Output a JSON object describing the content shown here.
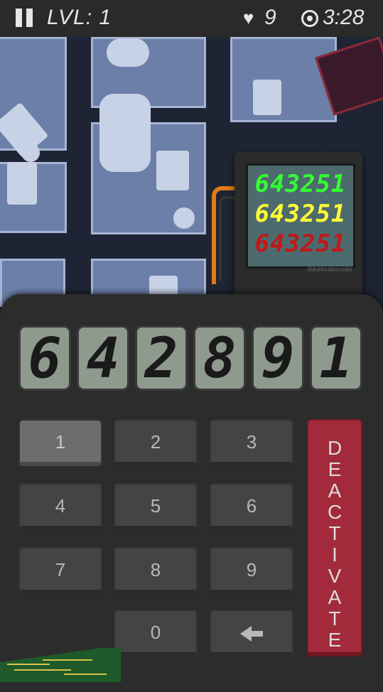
{
  "hud": {
    "level": "LVL: 1",
    "lives": "9",
    "timer": "3:28",
    "icons": [
      "pause-icon",
      "heart-icon",
      "clock-icon"
    ]
  },
  "device": {
    "codes": [
      "643251",
      "643251",
      "643251"
    ],
    "code_colors": [
      "#33ff33",
      "#ffff33",
      "#c01818"
    ],
    "brand": "iliketodecode"
  },
  "keypad": {
    "display": [
      "6",
      "4",
      "2",
      "8",
      "9",
      "1"
    ],
    "keys": [
      "1",
      "2",
      "3",
      "4",
      "5",
      "6",
      "7",
      "8",
      "9",
      "0"
    ],
    "pressed_key": "1",
    "deactivate_label": "DEACTIVATE",
    "backspace_icon": "backspace-arrow-icon"
  }
}
